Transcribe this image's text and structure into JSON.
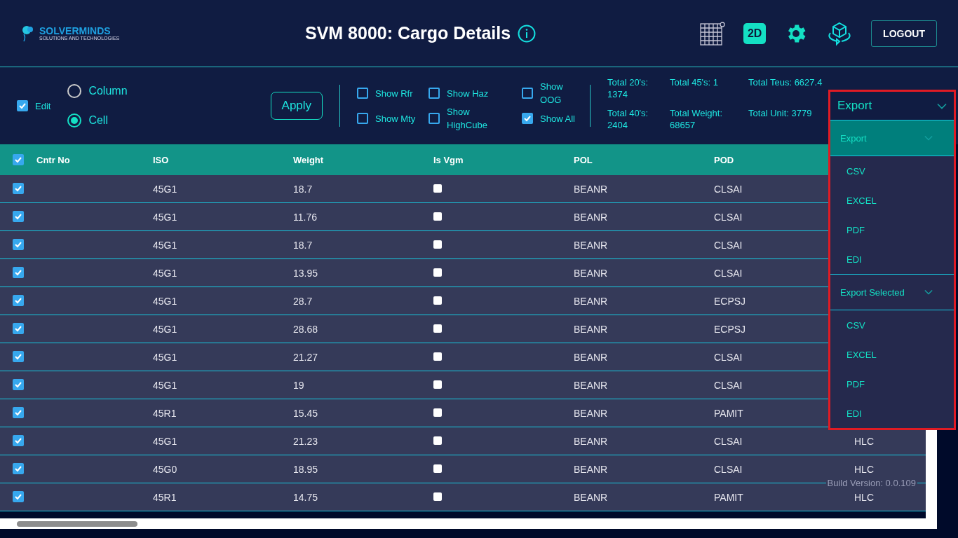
{
  "header": {
    "logo": {
      "name": "SOLVERMINDS",
      "tagline": "SOLUTIONS AND TECHNOLOGIES"
    },
    "title": "SVM 8000: Cargo Details",
    "view_badge": "2D",
    "logout": "LOGOUT"
  },
  "toolbar": {
    "edit": {
      "label": "Edit",
      "checked": true
    },
    "modes": [
      {
        "label": "Column",
        "selected": false
      },
      {
        "label": "Cell",
        "selected": true
      }
    ],
    "apply": "Apply",
    "filters": [
      {
        "label": "Show Rfr",
        "checked": false
      },
      {
        "label": "Show Mty",
        "checked": false
      },
      {
        "label": "Show Haz",
        "checked": false
      },
      {
        "label": "Show HighCube",
        "checked": false
      },
      {
        "label": "Show OOG",
        "checked": false
      },
      {
        "label": "Show All",
        "checked": true
      }
    ],
    "totals": [
      {
        "label": "Total 20's:",
        "value": "1374"
      },
      {
        "label": "Total 40's:",
        "value": "2404"
      },
      {
        "label": "Total 45's:",
        "value": "1"
      },
      {
        "label": "Total Weight:",
        "value": "68657"
      },
      {
        "label": "Total Teus:",
        "value": "6627.4"
      },
      {
        "label": "Total Unit:",
        "value": "3779"
      }
    ],
    "export": {
      "label": "Export",
      "expanded": true,
      "sections": [
        {
          "title": "Export",
          "selected": true,
          "items": [
            "CSV",
            "EXCEL",
            "PDF",
            "EDI"
          ]
        },
        {
          "title": "Export Selected",
          "selected": false,
          "items": [
            "CSV",
            "EXCEL",
            "PDF",
            "EDI"
          ]
        }
      ]
    }
  },
  "table": {
    "all_selected": true,
    "columns": [
      "Cntr No",
      "ISO",
      "Weight",
      "Is Vgm",
      "POL",
      "POD"
    ],
    "rows": [
      {
        "selected": true,
        "iso": "45G1",
        "weight": "18.7",
        "vgm": false,
        "pol": "BEANR",
        "pod": "CLSAI"
      },
      {
        "selected": true,
        "iso": "45G1",
        "weight": "11.76",
        "vgm": false,
        "pol": "BEANR",
        "pod": "CLSAI"
      },
      {
        "selected": true,
        "iso": "45G1",
        "weight": "18.7",
        "vgm": false,
        "pol": "BEANR",
        "pod": "CLSAI"
      },
      {
        "selected": true,
        "iso": "45G1",
        "weight": "13.95",
        "vgm": false,
        "pol": "BEANR",
        "pod": "CLSAI"
      },
      {
        "selected": true,
        "iso": "45G1",
        "weight": "28.7",
        "vgm": false,
        "pol": "BEANR",
        "pod": "ECPSJ"
      },
      {
        "selected": true,
        "iso": "45G1",
        "weight": "28.68",
        "vgm": false,
        "pol": "BEANR",
        "pod": "ECPSJ"
      },
      {
        "selected": true,
        "iso": "45G1",
        "weight": "21.27",
        "vgm": false,
        "pol": "BEANR",
        "pod": "CLSAI"
      },
      {
        "selected": true,
        "iso": "45G1",
        "weight": "19",
        "vgm": false,
        "pol": "BEANR",
        "pod": "CLSAI"
      },
      {
        "selected": true,
        "iso": "45R1",
        "weight": "15.45",
        "vgm": false,
        "pol": "BEANR",
        "pod": "PAMIT"
      },
      {
        "selected": true,
        "iso": "45G1",
        "weight": "21.23",
        "vgm": false,
        "pol": "BEANR",
        "pod": "CLSAI",
        "column_7": "HLC"
      },
      {
        "selected": true,
        "iso": "45G0",
        "weight": "18.95",
        "vgm": false,
        "pol": "BEANR",
        "pod": "CLSAI",
        "column_7": "HLC"
      },
      {
        "selected": true,
        "iso": "45R1",
        "weight": "14.75",
        "vgm": false,
        "pol": "BEANR",
        "pod": "PAMIT",
        "column_7": "HLC"
      }
    ]
  },
  "build_version": "Build Version: 0.0.109"
}
